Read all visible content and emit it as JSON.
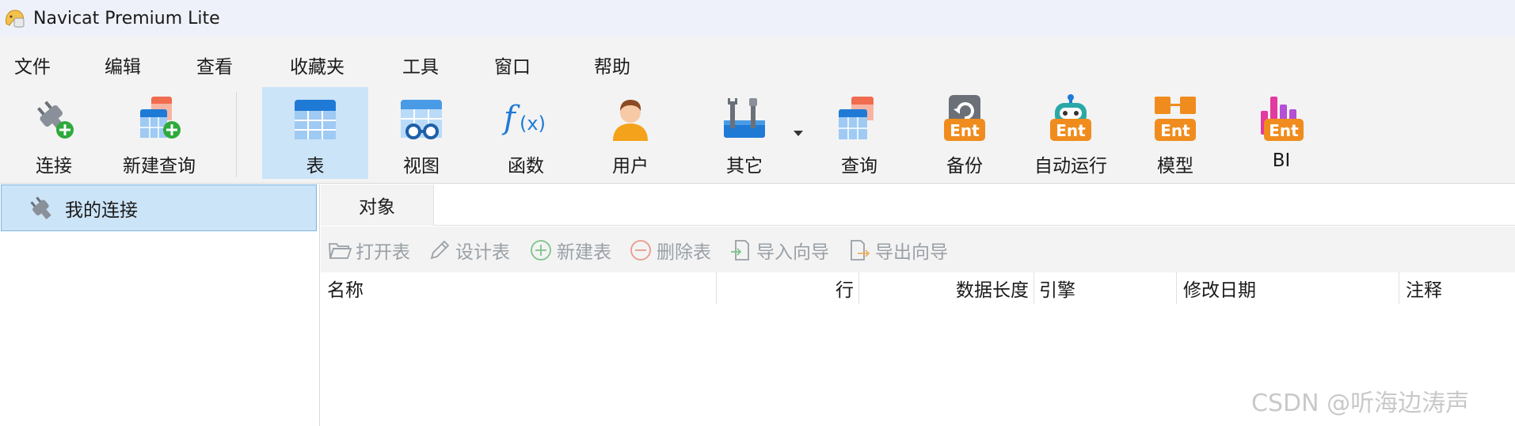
{
  "window": {
    "title": "Navicat Premium Lite",
    "app_icon": "navicat-logo-icon"
  },
  "menu": [
    "文件",
    "编辑",
    "查看",
    "收藏夹",
    "工具",
    "窗口",
    "帮助"
  ],
  "toolbar": {
    "buttons": [
      {
        "label": "连接",
        "icon": "plug-add-icon"
      },
      {
        "label": "新建查询",
        "icon": "new-query-icon"
      },
      {
        "label": "表",
        "icon": "table-icon",
        "active": true
      },
      {
        "label": "视图",
        "icon": "view-icon"
      },
      {
        "label": "函数",
        "icon": "function-icon",
        "icon_text": "f(x)"
      },
      {
        "label": "用户",
        "icon": "user-icon"
      },
      {
        "label": "其它",
        "icon": "tools-icon",
        "has_dropdown": true
      },
      {
        "label": "查询",
        "icon": "query-icon"
      },
      {
        "label": "备份",
        "icon": "backup-icon",
        "badge": "Ent"
      },
      {
        "label": "自动运行",
        "icon": "automation-robot-icon",
        "badge": "Ent"
      },
      {
        "label": "模型",
        "icon": "model-icon",
        "badge": "Ent"
      },
      {
        "label": "BI",
        "icon": "bi-chart-icon",
        "badge": "Ent"
      }
    ]
  },
  "connections": [
    {
      "label": "我的连接",
      "icon": "connection-plug-icon",
      "selected": true
    }
  ],
  "tabs": [
    {
      "label": "对象"
    }
  ],
  "object_toolbar": [
    {
      "label": "打开表",
      "icon": "folder-open-icon",
      "enabled": false
    },
    {
      "label": "设计表",
      "icon": "pencil-icon",
      "enabled": false
    },
    {
      "label": "新建表",
      "icon": "plus-circle-icon",
      "enabled": false
    },
    {
      "label": "删除表",
      "icon": "minus-circle-icon",
      "enabled": false
    },
    {
      "label": "导入向导",
      "icon": "import-icon",
      "enabled": false
    },
    {
      "label": "导出向导",
      "icon": "export-icon",
      "enabled": false
    }
  ],
  "grid": {
    "columns": [
      "名称",
      "行",
      "数据长度",
      "引擎",
      "修改日期",
      "注释"
    ],
    "rows": []
  },
  "watermark": "CSDN @听海边涛声",
  "colors": {
    "selection": "#cce4f7",
    "toolbar_bg": "#f3f3f3",
    "ent_badge": "#f08c1e",
    "disabled_text": "#9aa0a6"
  }
}
